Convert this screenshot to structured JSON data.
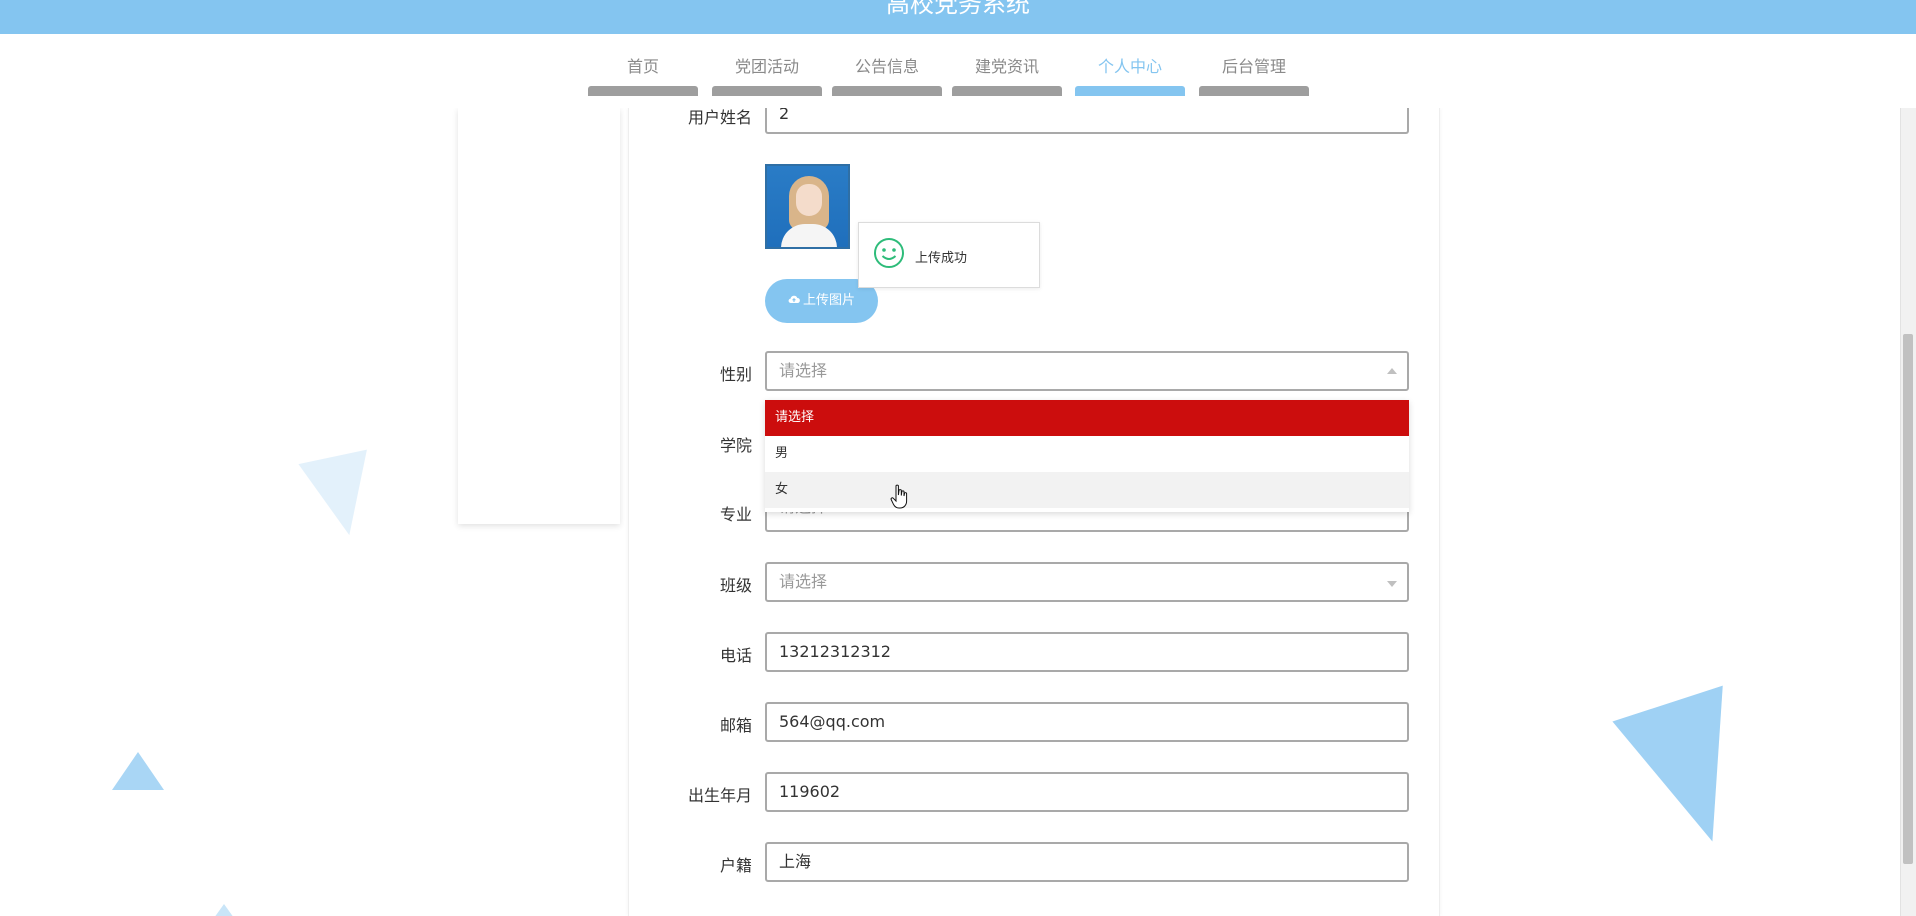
{
  "header": {
    "title": "高校党务系统"
  },
  "nav": {
    "items": [
      {
        "label": "首页"
      },
      {
        "label": "党团活动"
      },
      {
        "label": "公告信息"
      },
      {
        "label": "建党资讯"
      },
      {
        "label": "个人中心",
        "active": true
      },
      {
        "label": "后台管理"
      }
    ]
  },
  "form": {
    "name_label": "用户姓名",
    "name_value": "2",
    "upload_button": "上传图片",
    "toast_message": "上传成功",
    "gender_label": "性别",
    "gender_value": "请选择",
    "gender_options": [
      "请选择",
      "男",
      "女"
    ],
    "college_label": "学院",
    "major_label": "专业",
    "major_value": "请选择",
    "class_label": "班级",
    "class_value": "请选择",
    "phone_label": "电话",
    "phone_value": "13212312312",
    "email_label": "邮箱",
    "email_value": "564@qq.com",
    "birth_label": "出生年月",
    "birth_value": "119602",
    "origin_label": "户籍",
    "origin_value": "上海"
  },
  "icons": {
    "upload": "cloud-upload-icon",
    "toast": "smile-icon",
    "cursor": "hand-pointer-icon"
  },
  "colors": {
    "accent": "#84c5f0",
    "selected_option": "#cc0d0d",
    "toast_icon": "#2ebc7a"
  }
}
